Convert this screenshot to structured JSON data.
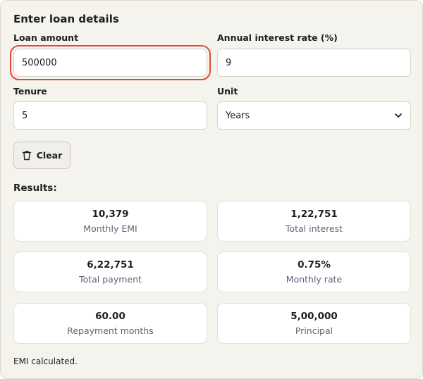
{
  "form": {
    "heading": "Enter loan details",
    "loan_amount": {
      "label": "Loan amount",
      "value": "500000"
    },
    "interest_rate": {
      "label": "Annual interest rate (%)",
      "value": "9"
    },
    "tenure": {
      "label": "Tenure",
      "value": "5"
    },
    "unit": {
      "label": "Unit",
      "selected": "Years"
    },
    "clear_label": "Clear"
  },
  "results": {
    "heading": "Results:",
    "cards": [
      {
        "value": "10,379",
        "caption": "Monthly EMI"
      },
      {
        "value": "1,22,751",
        "caption": "Total interest"
      },
      {
        "value": "6,22,751",
        "caption": "Total payment"
      },
      {
        "value": "0.75%",
        "caption": "Monthly rate"
      },
      {
        "value": "60.00",
        "caption": "Repayment months"
      },
      {
        "value": "5,00,000",
        "caption": "Principal"
      }
    ]
  },
  "status": "EMI calculated.",
  "colors": {
    "panel_bg": "#f5f3ed",
    "focus_ring": "#e04a33",
    "caption_text": "#5b6478"
  }
}
